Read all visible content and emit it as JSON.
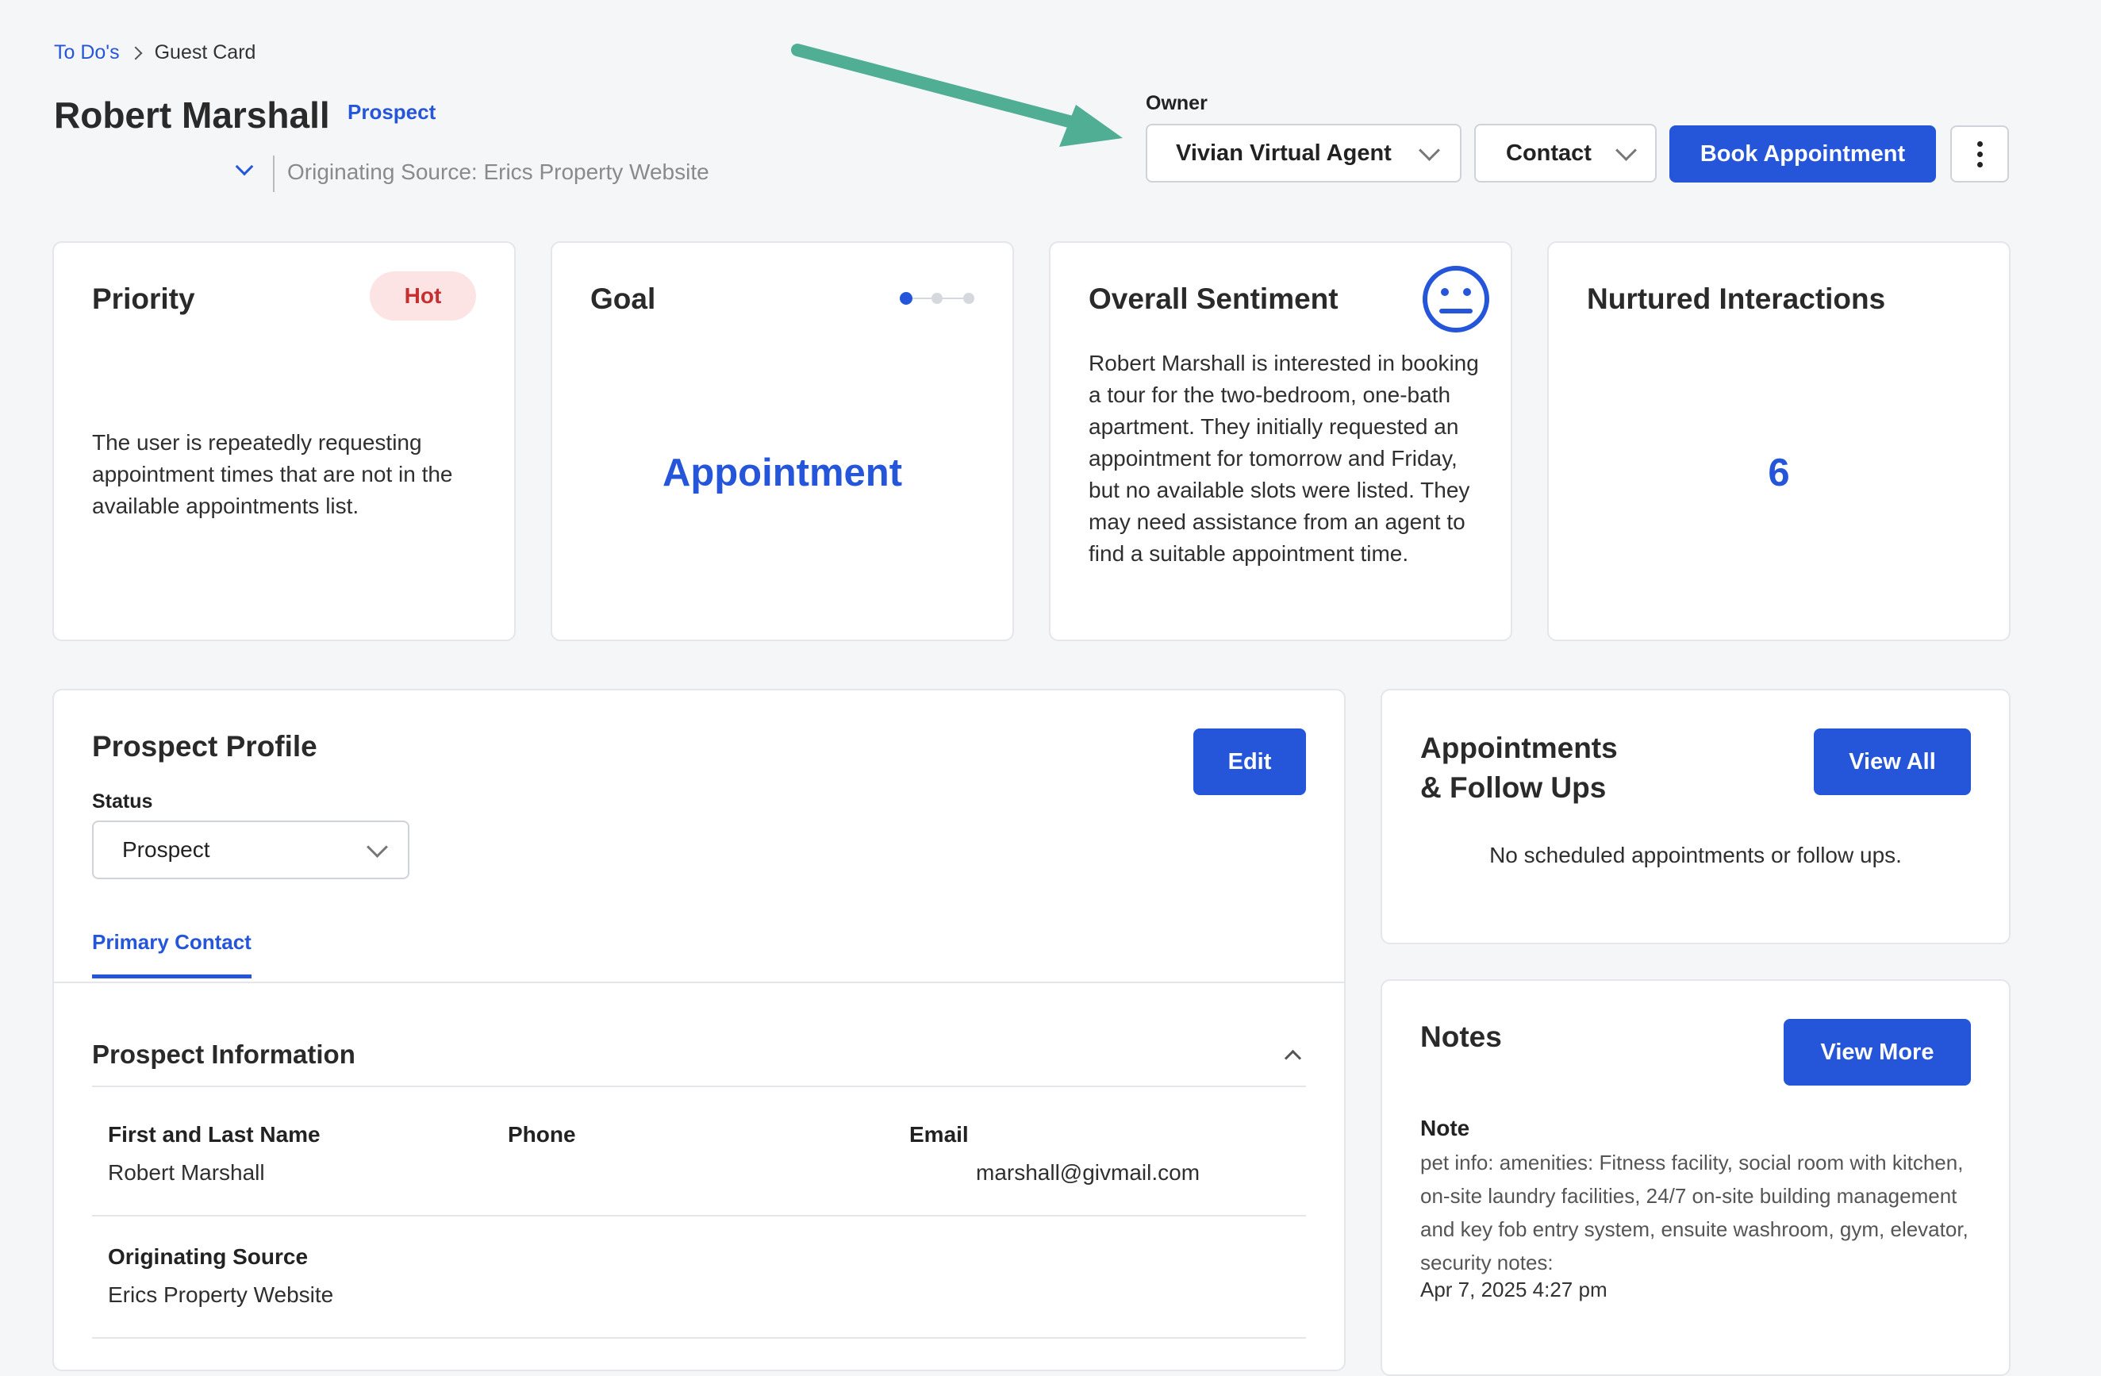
{
  "breadcrumb": {
    "parent": "To Do's",
    "current": "Guest Card"
  },
  "header": {
    "name": "Robert Marshall",
    "badge": "Prospect",
    "source_text": "Originating Source: Erics Property Website",
    "owner_label": "Owner",
    "owner_value": "Vivian Virtual Agent",
    "contact_label": "Contact",
    "book_label": "Book Appointment"
  },
  "priority": {
    "title": "Priority",
    "badge": "Hot",
    "text": "The user is repeatedly requesting appointment times that are not in the available appointments list."
  },
  "goal": {
    "title": "Goal",
    "value": "Appointment",
    "step_current": 1,
    "step_total": 3
  },
  "sentiment": {
    "title": "Overall Sentiment",
    "icon": "neutral-face-icon",
    "text": "Robert Marshall is interested in booking a tour for the two-bedroom, one-bath apartment. They initially requested an appointment for tomorrow and Friday, but no available slots were listed. They may need assistance from an agent to find a suitable appointment time."
  },
  "nurtured": {
    "title": "Nurtured Interactions",
    "value": "6"
  },
  "profile": {
    "title": "Prospect Profile",
    "edit_label": "Edit",
    "status_label": "Status",
    "status_value": "Prospect",
    "tab": "Primary Contact",
    "section_title": "Prospect Information",
    "fields": {
      "name_label": "First and Last Name",
      "name_value": "Robert Marshall",
      "phone_label": "Phone",
      "phone_value": "",
      "email_label": "Email",
      "email_value": "marshall@givmail.com",
      "source_label": "Originating Source",
      "source_value": "Erics Property Website"
    }
  },
  "appointments": {
    "title_line1": "Appointments",
    "title_line2": "& Follow Ups",
    "view_all": "View All",
    "empty": "No scheduled appointments or follow ups."
  },
  "notes": {
    "title": "Notes",
    "view_more": "View More",
    "note_label": "Note",
    "note_text": "pet info: amenities: Fitness facility, social room with kitchen, on-site laundry facilities, 24/7 on-site building management and key fob entry system, ensuite washroom, gym, elevator, security notes:",
    "note_date": "Apr 7, 2025 4:27 pm"
  },
  "colors": {
    "primary": "#2556d9",
    "hot_bg": "#fde4e4",
    "hot_text": "#c62f2f",
    "annotation_arrow": "#4fae94"
  }
}
